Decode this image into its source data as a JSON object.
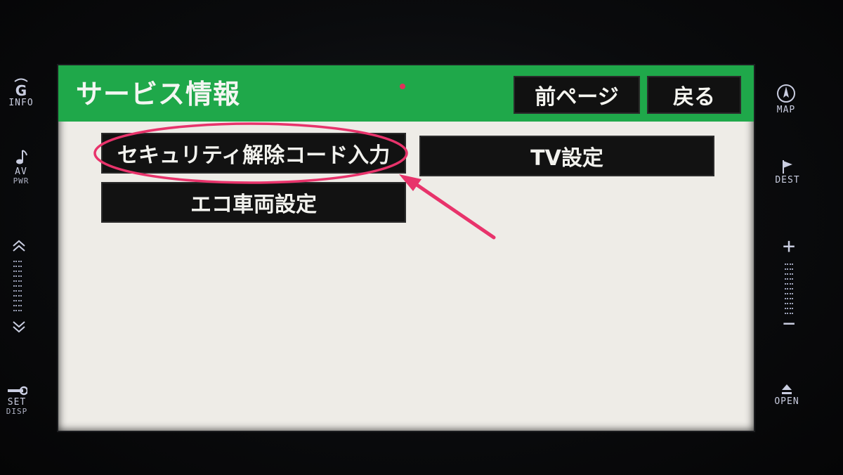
{
  "left_panel": {
    "info": {
      "label": "INFO",
      "icon": "g-info-icon"
    },
    "av": {
      "label": "AV",
      "sub": "PWR",
      "icon": "music-note-icon"
    },
    "scroll": {
      "icon_up": "double-chevron-up-icon",
      "icon_down": "double-chevron-down-icon"
    },
    "set": {
      "label": "SET",
      "sub": "DISP",
      "icon": "wrench-icon"
    }
  },
  "right_panel": {
    "map": {
      "label": "MAP",
      "icon": "compass-icon"
    },
    "dest": {
      "label": "DEST",
      "icon": "flag-icon"
    },
    "volume": {
      "plus": "+",
      "minus": "−"
    },
    "open": {
      "label": "OPEN",
      "icon": "eject-icon"
    }
  },
  "screen": {
    "title": "サービス情報",
    "prev_page": "前ページ",
    "back": "戻る",
    "buttons": {
      "security": "セキュリティ解除コード入力",
      "tv": "TV設定",
      "eco": "エコ車両設定"
    }
  },
  "colors": {
    "header_green": "#1fa84a",
    "annotation_pink": "#e8336b"
  }
}
